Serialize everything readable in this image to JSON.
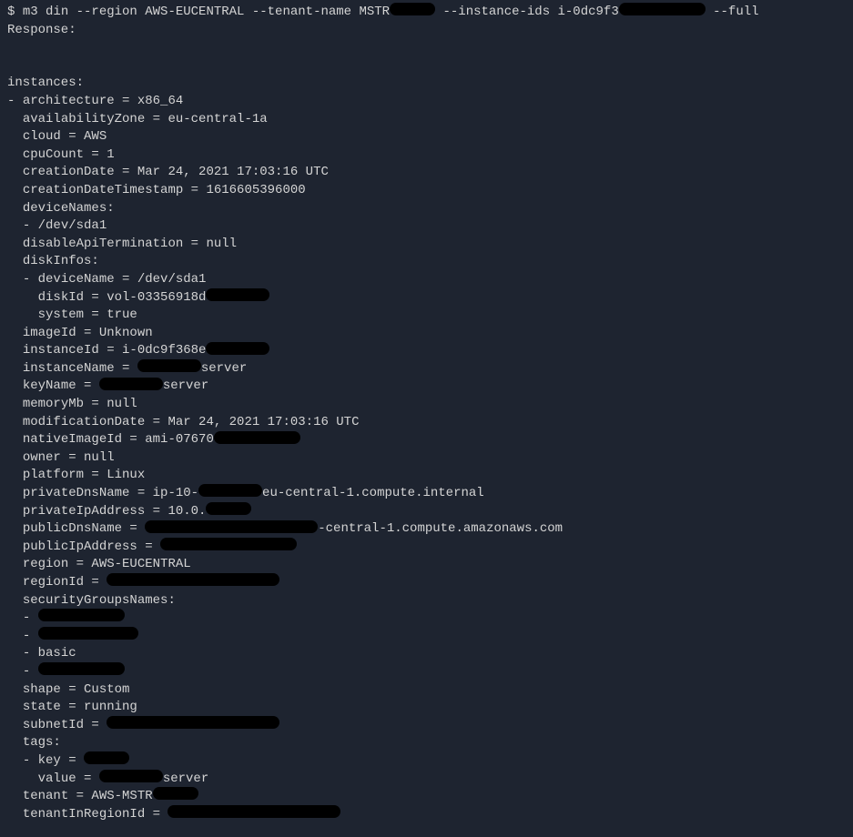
{
  "prompt": {
    "symbol": "$",
    "cmd_part1": "m3 din --region AWS-EUCENTRAL --tenant-name MSTR",
    "cmd_part2": "--instance-ids i-0dc9f3",
    "cmd_part3": "--full"
  },
  "response_label": "Response:",
  "output": {
    "instances_header": "instances:",
    "dash": "- ",
    "arch": "architecture = x86_64",
    "az": "availabilityZone = eu-central-1a",
    "cloud": "cloud = AWS",
    "cpu": "cpuCount = 1",
    "created": "creationDate = Mar 24, 2021 17:03:16 UTC",
    "created_ts": "creationDateTimestamp = 1616605396000",
    "devnames_header": "deviceNames:",
    "devname1": "- /dev/sda1",
    "disable_api": "disableApiTermination = null",
    "diskinfos_header": "diskInfos:",
    "disk_devname": "- deviceName = /dev/sda1",
    "disk_id_prefix": "diskId = vol-03356918d",
    "disk_system": "system = true",
    "image_id": "imageId = Unknown",
    "instance_id_prefix": "instanceId = i-0dc9f368e",
    "instance_name_prefix": "instanceName = ",
    "instance_name_suffix": "server",
    "keyname_prefix": "keyName = ",
    "keyname_suffix": "server",
    "memory": "memoryMb = null",
    "modified": "modificationDate = Mar 24, 2021 17:03:16 UTC",
    "native_image_prefix": "nativeImageId = ami-07670",
    "owner": "owner = null",
    "platform": "platform = Linux",
    "private_dns_prefix": "privateDnsName = ip-10-",
    "private_dns_suffix": "eu-central-1.compute.internal",
    "private_ip_prefix": "privateIpAddress = 10.0.",
    "public_dns_prefix": "publicDnsName = ",
    "public_dns_suffix": "-central-1.compute.amazonaws.com",
    "public_ip_prefix": "publicIpAddress = ",
    "region": "region = AWS-EUCENTRAL",
    "region_id_prefix": "regionId = ",
    "sg_header": "securityGroupsNames:",
    "sg_dash1": "- ",
    "sg_dash2": "- ",
    "sg_basic": "- basic",
    "sg_dash4": "- ",
    "shape": "shape = Custom",
    "state": "state = running",
    "subnet_prefix": "subnetId = ",
    "tags_header": "tags:",
    "tag_key_prefix": "- key = ",
    "tag_value_prefix": "value = ",
    "tag_value_suffix": "server",
    "tenant_prefix": "tenant = AWS-MSTR",
    "tenant_region_prefix": "tenantInRegionId = "
  }
}
